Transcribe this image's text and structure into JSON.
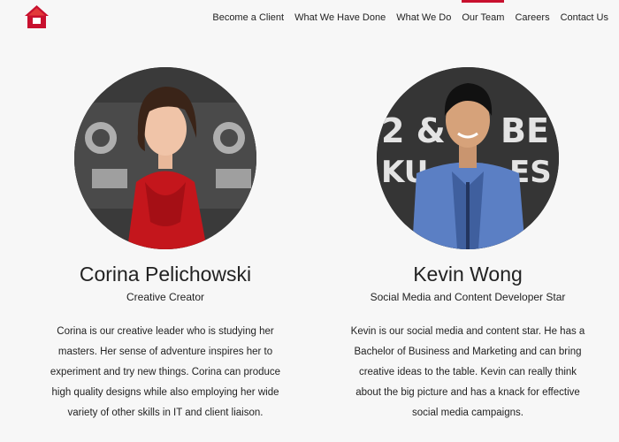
{
  "nav": {
    "items": [
      {
        "label": "Become a Client",
        "active": false
      },
      {
        "label": "What We Have Done",
        "active": false
      },
      {
        "label": "What We Do",
        "active": false
      },
      {
        "label": "Our Team",
        "active": true
      },
      {
        "label": "Careers",
        "active": false
      },
      {
        "label": "Contact Us",
        "active": false
      }
    ]
  },
  "team": [
    {
      "name": "Corina Pelichowski",
      "role": "Creative Creator",
      "bio": "Corina is our creative leader who is studying her masters. Her sense of adventure inspires her to experiment and try new things. Corina can produce high quality designs while also employing her wide variety of other skills in IT and client liaison."
    },
    {
      "name": "Kevin Wong",
      "role": "Social Media and Content Developer Star",
      "bio": "Kevin is our social media and content star. He has a Bachelor of Business and Marketing and can bring creative ideas to the table. Kevin can really think about the big picture and has a knack for effective social media campaigns."
    }
  ],
  "colors": {
    "accent": "#c8102e",
    "background": "#f7f7f7"
  }
}
